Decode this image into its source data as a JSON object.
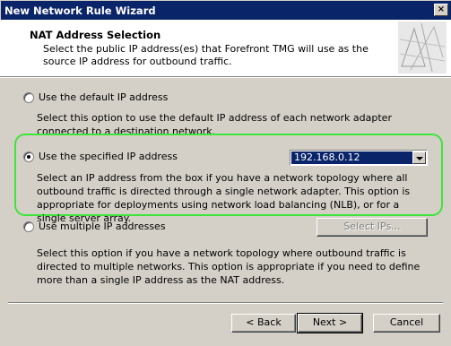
{
  "window": {
    "title": "New Network Rule Wizard",
    "close_glyph": "×"
  },
  "header": {
    "title": "NAT Address Selection",
    "description": "Select the public IP address(es) that Forefront TMG will use as the source IP address for outbound traffic."
  },
  "options": [
    {
      "label": "Use the default IP address",
      "selected": false,
      "description": "Select this option to use the default IP address of each network adapter connected to a destination network."
    },
    {
      "label": "Use the specified IP address",
      "selected": true,
      "description": "Select an IP address from the box if you have a network topology where all outbound traffic is directed through a single network adapter. This option is appropriate for deployments using network load balancing (NLB), or for a single server array."
    },
    {
      "label": "Use multiple IP addresses",
      "selected": false,
      "description": "Select this option if you have a network topology where outbound traffic is directed to multiple networks. This option is appropriate if you need to define more than a single IP address as the NAT address."
    }
  ],
  "ip_select": {
    "value": "192.168.0.12"
  },
  "select_ips_button": "Select IPs...",
  "footer": {
    "back": "< Back",
    "next": "Next >",
    "cancel": "Cancel"
  },
  "colors": {
    "title_bar": "#0a246a",
    "highlight": "#3ee43a",
    "face": "#d4d0c8"
  }
}
